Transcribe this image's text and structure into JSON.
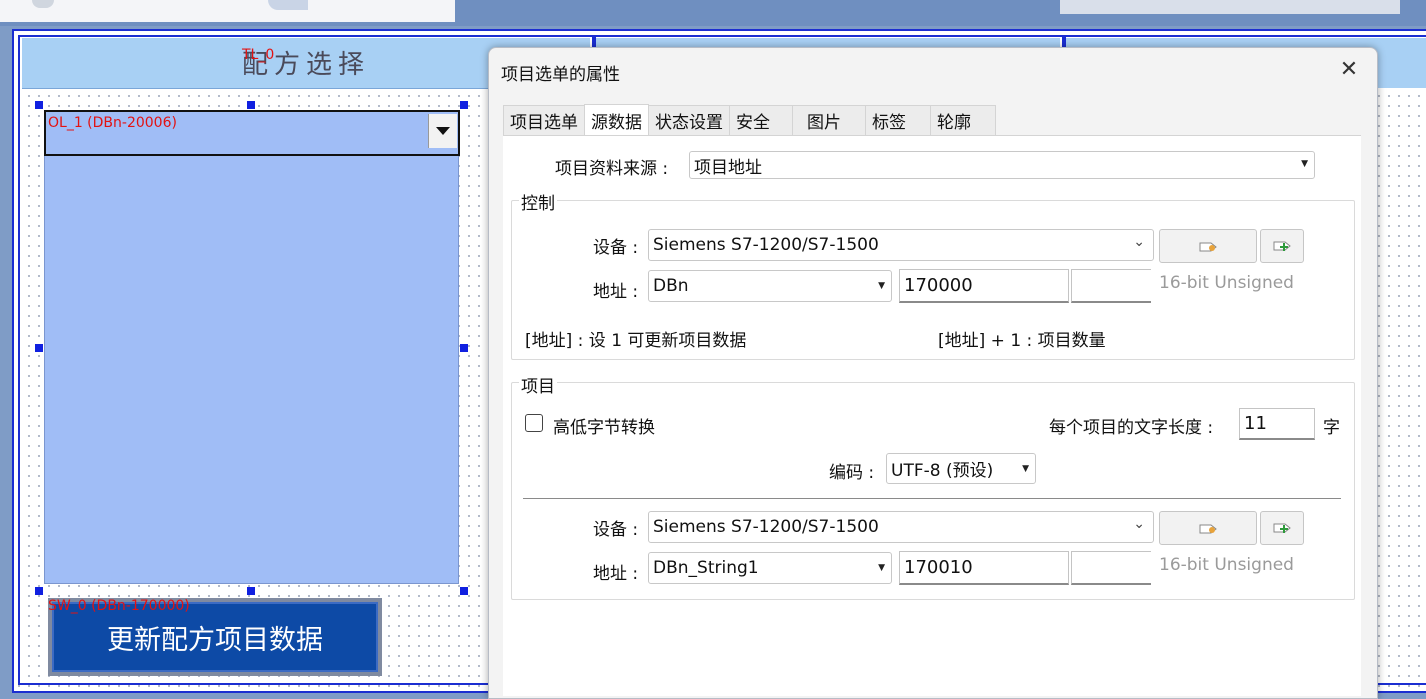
{
  "hmi": {
    "recipe_title": "配方选择",
    "list_label": "OL_1 (DBn-20006)",
    "overlay_label": "TL_0",
    "button_label": "SW_0 (DBn-170000)",
    "update_button": "更新配方项目数据"
  },
  "dialog": {
    "title": "项目选单的属性",
    "close": "✕",
    "tabs": [
      "项目选单",
      "源数据",
      "状态设置",
      "安全",
      "图片",
      "标签",
      "轮廓"
    ],
    "active_tab": "源数据",
    "source_label": "项目资料来源 :",
    "source_value": "项目地址",
    "control": {
      "legend": "控制",
      "device_label": "设备 :",
      "device_value": "Siemens S7-1200/S7-1500",
      "address_label": "地址 :",
      "address_type": "DBn",
      "address_value": "170000",
      "data_type": "16-bit Unsigned",
      "note_left": "[地址] : 设 1 可更新项目数据",
      "note_right": "[地址] + 1 : 项目数量"
    },
    "item": {
      "legend": "项目",
      "byte_swap_label": "高低字节转换",
      "byte_swap_checked": false,
      "text_length_label": "每个项目的文字长度 :",
      "text_length_value": "11",
      "text_length_unit": "字",
      "encoding_label": "编码 :",
      "encoding_value": "UTF-8 (预设)",
      "device_label": "设备 :",
      "device_value": "Siemens S7-1200/S7-1500",
      "address_label": "地址 :",
      "address_type": "DBn_String1",
      "address_value": "170010",
      "data_type": "16-bit Unsigned"
    }
  }
}
